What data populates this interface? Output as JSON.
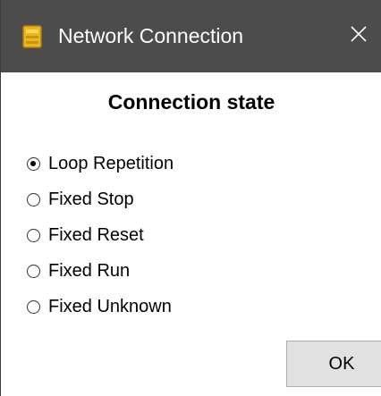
{
  "window": {
    "title": "Network Connection",
    "icon": "yellow-app-icon",
    "close_icon": "close-icon"
  },
  "dialog": {
    "heading": "Connection state",
    "options": [
      {
        "label": "Loop Repetition",
        "checked": true
      },
      {
        "label": "Fixed Stop",
        "checked": false
      },
      {
        "label": "Fixed Reset",
        "checked": false
      },
      {
        "label": "Fixed Run",
        "checked": false
      },
      {
        "label": "Fixed Unknown",
        "checked": false
      }
    ],
    "ok_label": "OK"
  },
  "colors": {
    "titlebar": "#4c4c4c",
    "title_text": "#ffffff",
    "button_face": "#e1e1e1",
    "button_border": "#adadad",
    "app_icon": "#e8b81c"
  }
}
